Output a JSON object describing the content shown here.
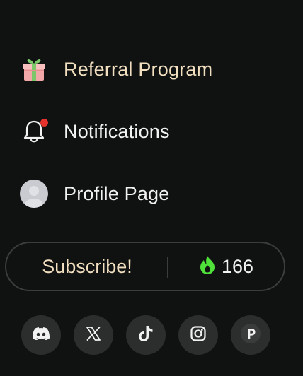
{
  "menu": {
    "items": [
      {
        "label": "Referral Program",
        "icon": "gift-icon"
      },
      {
        "label": "Notifications",
        "icon": "bell-icon",
        "has_unread_dot": true
      },
      {
        "label": "Profile Page",
        "icon": "avatar"
      }
    ]
  },
  "subscribe": {
    "button_label": "Subscribe!",
    "streak_icon": "flame-icon",
    "streak_count": "166"
  },
  "socials": [
    {
      "name": "discord",
      "icon": "discord-icon"
    },
    {
      "name": "x",
      "icon": "x-icon"
    },
    {
      "name": "tiktok",
      "icon": "tiktok-icon"
    },
    {
      "name": "instagram",
      "icon": "instagram-icon"
    },
    {
      "name": "p",
      "icon": "p-icon"
    }
  ],
  "colors": {
    "background": "#101212",
    "accent_text": "#f1dfc0",
    "notification_dot": "#e5322d",
    "flame": "#4fe03a"
  }
}
